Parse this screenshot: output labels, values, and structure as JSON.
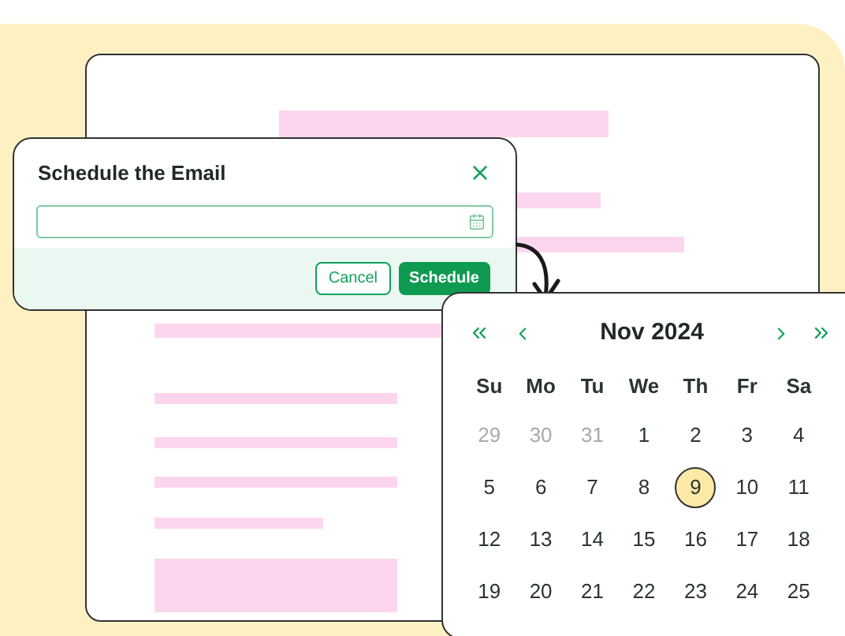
{
  "dialog": {
    "title": "Schedule the Email",
    "buttons": [
      {
        "label": "Cancel",
        "kind": "secondary"
      },
      {
        "label": "Schedule",
        "kind": "primary"
      }
    ]
  },
  "calendar": {
    "month": "Nov 2024",
    "weekdays": [
      "Su",
      "Mo",
      "Tu",
      "We",
      "Th",
      "Fr",
      "Sa"
    ],
    "weeks": [
      [
        {
          "label": "29",
          "outside": true,
          "selected": false
        },
        {
          "label": "30",
          "outside": true,
          "selected": false
        },
        {
          "label": "31",
          "outside": true,
          "selected": false
        },
        {
          "label": "1",
          "outside": false,
          "selected": false
        },
        {
          "label": "2",
          "outside": false,
          "selected": false
        },
        {
          "label": "3",
          "outside": false,
          "selected": false
        },
        {
          "label": "4",
          "outside": false,
          "selected": false
        }
      ],
      [
        {
          "label": "5",
          "outside": false,
          "selected": false
        },
        {
          "label": "6",
          "outside": false,
          "selected": false
        },
        {
          "label": "7",
          "outside": false,
          "selected": false
        },
        {
          "label": "8",
          "outside": false,
          "selected": false
        },
        {
          "label": "9",
          "outside": false,
          "selected": true
        },
        {
          "label": "10",
          "outside": false,
          "selected": false
        },
        {
          "label": "11",
          "outside": false,
          "selected": false
        }
      ],
      [
        {
          "label": "12",
          "outside": false,
          "selected": false
        },
        {
          "label": "13",
          "outside": false,
          "selected": false
        },
        {
          "label": "14",
          "outside": false,
          "selected": false
        },
        {
          "label": "15",
          "outside": false,
          "selected": false
        },
        {
          "label": "16",
          "outside": false,
          "selected": false
        },
        {
          "label": "17",
          "outside": false,
          "selected": false
        },
        {
          "label": "18",
          "outside": false,
          "selected": false
        }
      ],
      [
        {
          "label": "19",
          "outside": false,
          "selected": false
        },
        {
          "label": "20",
          "outside": false,
          "selected": false
        },
        {
          "label": "21",
          "outside": false,
          "selected": false
        },
        {
          "label": "22",
          "outside": false,
          "selected": false
        },
        {
          "label": "23",
          "outside": false,
          "selected": false
        },
        {
          "label": "24",
          "outside": false,
          "selected": false
        },
        {
          "label": "25",
          "outside": false,
          "selected": false
        }
      ]
    ]
  }
}
